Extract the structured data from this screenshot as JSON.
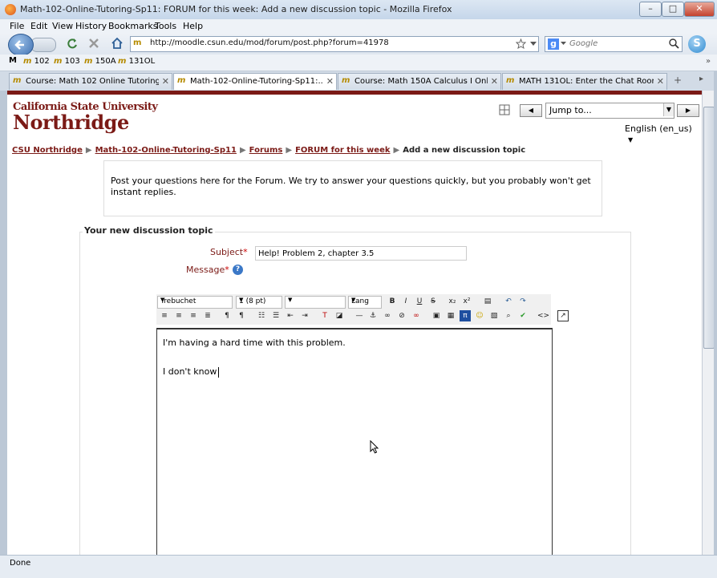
{
  "window": {
    "title": "Math-102-Online-Tutoring-Sp11: FORUM for this week: Add a new discussion topic - Mozilla Firefox",
    "min": "–",
    "max": "□",
    "close": "✕"
  },
  "menu": [
    {
      "label": "File"
    },
    {
      "label": "Edit"
    },
    {
      "label": "View"
    },
    {
      "label": "History"
    },
    {
      "label": "Bookmarks"
    },
    {
      "label": "Tools"
    },
    {
      "label": "Help"
    }
  ],
  "nav": {
    "url": "http://moodle.csun.edu/mod/forum/post.php?forum=41978",
    "search_placeholder": "Google"
  },
  "bookmarks": [
    {
      "label": "102"
    },
    {
      "label": "103"
    },
    {
      "label": "150A"
    },
    {
      "label": "131OL"
    }
  ],
  "tabs": [
    {
      "label": "Course: Math 102 Online Tutoring S...",
      "active": false
    },
    {
      "label": "Math-102-Online-Tutoring-Sp11:...",
      "active": true
    },
    {
      "label": "Course: Math 150A Calculus I Onlin...",
      "active": false
    },
    {
      "label": "MATH 131OL: Enter the Chat Room",
      "active": false
    }
  ],
  "header": {
    "logo_line1": "California State University",
    "logo_line2": "Northridge",
    "jump_label": "Jump to...",
    "language": "English (en_us)"
  },
  "breadcrumb": {
    "items": [
      "CSU Northridge",
      "Math-102-Online-Tutoring-Sp11",
      "Forums",
      "FORUM for this week"
    ],
    "current": "Add a new discussion topic"
  },
  "intro_text": "Post your questions here for the Forum. We try to answer your questions quickly, but you probably won't get instant replies.",
  "form": {
    "legend": "Your new discussion topic",
    "subject_label": "Subject",
    "subject_value": "Help! Problem 2, chapter 3.5",
    "message_label": "Message"
  },
  "editor": {
    "font": "Trebuchet",
    "size": "1 (8 pt)",
    "lang": "Lang",
    "line1": "I'm having a hard time with this problem.",
    "line2": "I don't know"
  },
  "status": "Done"
}
